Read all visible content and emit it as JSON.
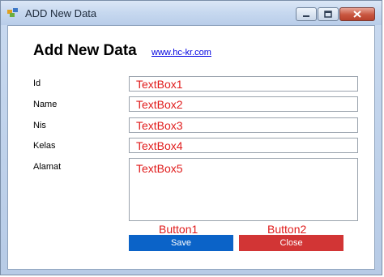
{
  "window": {
    "title": "ADD New Data",
    "controls": {
      "minimize_icon": "minimize-icon",
      "maximize_icon": "maximize-icon",
      "close_icon": "close-icon"
    }
  },
  "form": {
    "heading": "Add New Data",
    "link": "www.hc-kr.com",
    "fields": [
      {
        "label": "Id",
        "value": "TextBox1"
      },
      {
        "label": "Name",
        "value": "TextBox2"
      },
      {
        "label": "Nis",
        "value": "TextBox3"
      },
      {
        "label": "Kelas",
        "value": "TextBox4"
      },
      {
        "label": "Alamat",
        "value": "TextBox5"
      }
    ]
  },
  "buttons": {
    "save": {
      "caption": "Button1",
      "label": "Save",
      "color": "#0b63c8"
    },
    "close": {
      "caption": "Button2",
      "label": "Close",
      "color": "#d23535"
    }
  },
  "colors": {
    "placeholder_text": "#e01b1b",
    "link": "#0000e0"
  }
}
